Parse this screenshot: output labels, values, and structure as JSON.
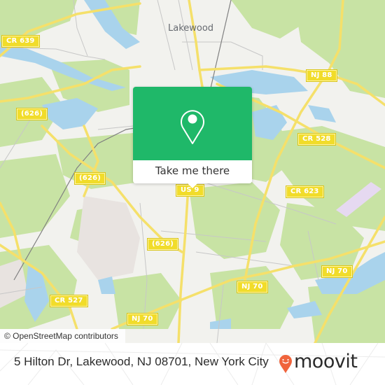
{
  "map": {
    "place_labels": [
      {
        "name": "Lakewood"
      }
    ],
    "road_shields": [
      {
        "id": "cr639",
        "label": "CR 639"
      },
      {
        "id": "nj88",
        "label": "NJ 88"
      },
      {
        "id": "626a",
        "label": "(626)"
      },
      {
        "id": "626b",
        "label": "(626)"
      },
      {
        "id": "626c",
        "label": "(626)"
      },
      {
        "id": "cr528",
        "label": "CR 528"
      },
      {
        "id": "us9",
        "label": "US 9"
      },
      {
        "id": "cr623",
        "label": "CR 623"
      },
      {
        "id": "nj70a",
        "label": "NJ 70"
      },
      {
        "id": "nj70b",
        "label": "NJ 70"
      },
      {
        "id": "nj70c",
        "label": "NJ 70"
      },
      {
        "id": "cr527",
        "label": "CR 527"
      }
    ],
    "attribution": "© OpenStreetMap contributors",
    "colors": {
      "land": "#f2f2ee",
      "forest": "#c8e3a4",
      "water": "#a9d3ec",
      "road_major": "#f5e06a",
      "road_minor": "#c7c7c7",
      "residential": "#e7e2df"
    }
  },
  "popup": {
    "icon": "map-pin-icon",
    "button_label": "Take me there",
    "color": "#1fb869"
  },
  "footer": {
    "address": "5 Hilton Dr, Lakewood, NJ 08701, New York City",
    "brand": "moovit",
    "brand_icon": "moovit-pin-smile-icon",
    "brand_color": "#f0643c"
  }
}
